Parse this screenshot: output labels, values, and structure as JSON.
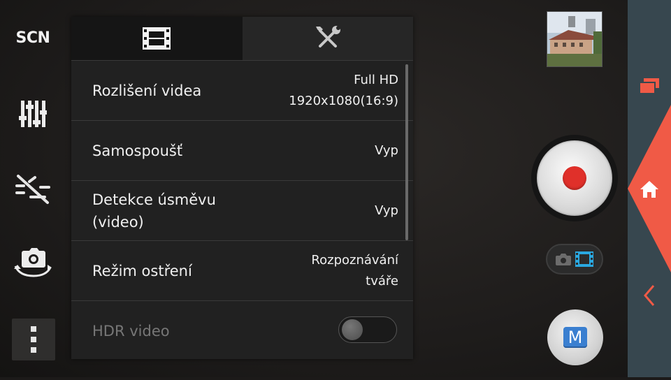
{
  "left_toolbar": {
    "scene_label": "SCN",
    "icons": [
      "scene-icon",
      "sliders-icon",
      "flash-off-icon",
      "switch-camera-icon",
      "overflow-menu-icon"
    ]
  },
  "panel": {
    "tabs": [
      {
        "icon": "film-icon",
        "active": true
      },
      {
        "icon": "wrench-screwdriver-icon",
        "active": false
      }
    ],
    "rows": [
      {
        "label": "Rozlišení videa",
        "value_line1": "Full HD",
        "value_line2": "1920x1080(16:9)"
      },
      {
        "label": "Samospoušť",
        "value_line1": "Vyp"
      },
      {
        "label_line1": "Detekce úsměvu",
        "label_line2": "(video)",
        "value_line1": "Vyp"
      },
      {
        "label": "Režim ostření",
        "value_line1": "Rozpoznávání",
        "value_line2": "tváře"
      },
      {
        "label": "HDR video",
        "toggle_on": false,
        "disabled": true
      }
    ]
  },
  "right_controls": {
    "record_color": "#e0302a",
    "manual_label": "M",
    "mode_active": "video"
  },
  "nav_bar": {
    "accent": "#f05a46",
    "icons": [
      "recents-icon",
      "home-icon",
      "back-icon"
    ]
  }
}
